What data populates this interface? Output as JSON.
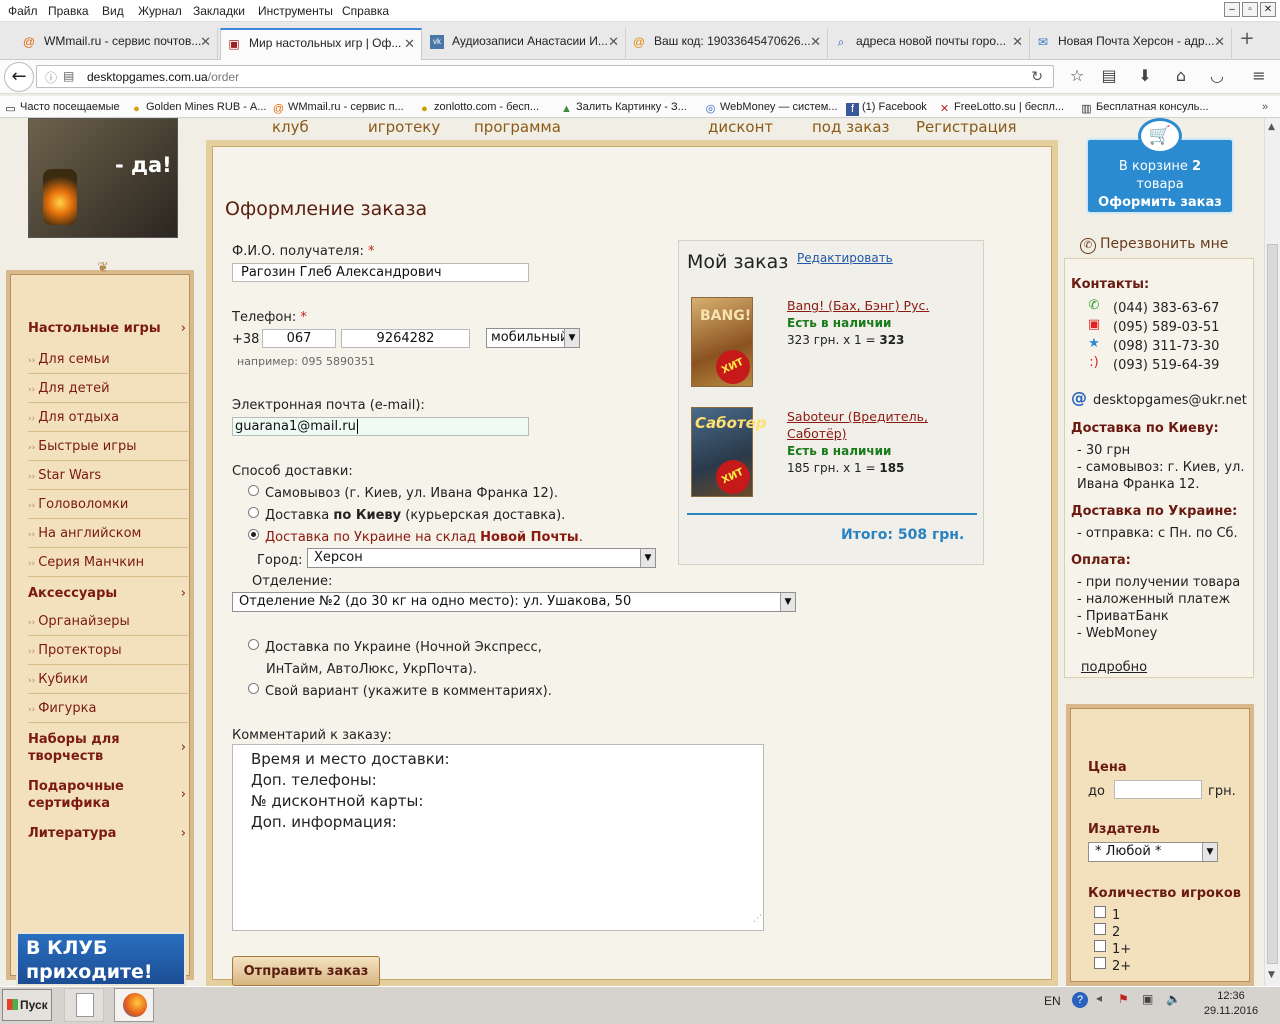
{
  "menubar": {
    "items": [
      "Файл",
      "Правка",
      "Вид",
      "Журнал",
      "Закладки",
      "Инструменты",
      "Справка"
    ]
  },
  "tabs": [
    {
      "label": "WMmail.ru - сервис почтов...",
      "icon": "at-icon"
    },
    {
      "label": "Мир настольных игр | Оф...",
      "icon": "boardgame-icon"
    },
    {
      "label": "Аудиозаписи Анастасии И...",
      "icon": "vk-icon"
    },
    {
      "label": "Ваш код: 19033645470626...",
      "icon": "mail-icon"
    },
    {
      "label": "адреса новой почты горо...",
      "icon": "search-icon"
    },
    {
      "label": "Новая Почта Херсон - адр...",
      "icon": "envelope-icon"
    }
  ],
  "url": {
    "host": "desktopgames.com.ua",
    "path": "/order"
  },
  "bookmarks": [
    "Часто посещаемые",
    "Golden Mines RUB - А...",
    "WMmail.ru - сервис п...",
    "zonlotto.com - бесп...",
    "Залить Картинку - З...",
    "WebMoney — систем...",
    "(1) Facebook",
    "FreeLotto.su | беспл...",
    "Бесплатная консуль..."
  ],
  "topnav": [
    "клуб",
    "игротеку",
    "программа",
    "дисконт",
    "под заказ",
    "Регистрация"
  ],
  "promo": {
    "text": "- да!"
  },
  "leftmenu": {
    "items": [
      {
        "type": "h",
        "label": "Настольные игры"
      },
      {
        "type": "i",
        "label": "Для семьи"
      },
      {
        "type": "i",
        "label": "Для детей"
      },
      {
        "type": "i",
        "label": "Для отдыха"
      },
      {
        "type": "i",
        "label": "Быстрые игры"
      },
      {
        "type": "i",
        "label": "Star Wars"
      },
      {
        "type": "i",
        "label": "Головоломки"
      },
      {
        "type": "i",
        "label": "На английском"
      },
      {
        "type": "i",
        "label": "Серия Манчкин"
      },
      {
        "type": "h",
        "label": "Аксессуары"
      },
      {
        "type": "i",
        "label": "Органайзеры"
      },
      {
        "type": "i",
        "label": "Протекторы"
      },
      {
        "type": "i",
        "label": "Кубики"
      },
      {
        "type": "i",
        "label": "Фигурка"
      },
      {
        "type": "h",
        "label": "Наборы для творчеств"
      },
      {
        "type": "h",
        "label": "Подарочные сертифика"
      },
      {
        "type": "h",
        "label": "Литература"
      }
    ]
  },
  "klub": {
    "line1": "В КЛУБ",
    "line2": "приходите!"
  },
  "form": {
    "title": "Оформление заказа",
    "fio_label": "Ф.И.О. получателя:",
    "fio_value": "Рагозин Глеб Александрович",
    "phone_label": "Телефон:",
    "phone_prefix": "+38",
    "phone_code": "067",
    "phone_number": "9264282",
    "phone_type": "мобильный",
    "phone_hint": "например: 095  5890351",
    "email_label": "Электронная почта (e-mail):",
    "email_value": "guarana1@mail.ru",
    "delivery_label": "Способ доставки:",
    "d1": "Самовывоз (г. Киев, ул. Ивана Франка 12).",
    "d2a": "Доставка ",
    "d2b": "по Киеву",
    "d2c": " (курьерская доставка).",
    "d3a": "Доставка по Украине на склад ",
    "d3b": "Новой Почты",
    "d3c": ".",
    "city_label": "Город:",
    "city_value": "Херсон",
    "branch_label": "Отделение:",
    "branch_value": "Отделение №2 (до 30 кг на одно место): ул. Ушакова, 50",
    "d4a": "Доставка по Украине (Ночной Экспресс,",
    "d4b": "ИнТайм, АвтоЛюкс, УкрПочта).",
    "d5": "Свой вариант (укажите в комментариях).",
    "comment_label": "Комментарий к заказу:",
    "comment_lines": [
      "Время и место доставки:",
      "Доп. телефоны:",
      "№ дисконтной карты:",
      "Доп. информация:"
    ],
    "submit": "Отправить заказ"
  },
  "order": {
    "title": "Мой заказ",
    "edit": "Редактировать",
    "items": [
      {
        "name": "Bang! (Бах, Бэнг) Рус.",
        "stock": "Есть в наличии",
        "price_text": "323 грн. x 1 = ",
        "sum": "323",
        "badge": "ХИТ",
        "img_text": "BANG!"
      },
      {
        "name": "Saboteur (Вредитель, Саботёр)",
        "stock": "Есть в наличии",
        "price_text": "185 грн. x 1 = ",
        "sum": "185",
        "badge": "ХИТ",
        "img_text": "Саботер"
      }
    ],
    "total": "Итого: 508 грн."
  },
  "cart": {
    "line1a": "В корзине ",
    "count": "2",
    "line2": "товара",
    "action": "Оформить заказ"
  },
  "callback": "Перезвонить мне",
  "contacts": {
    "title": "Контакты:",
    "phones": [
      "(044) 383-63-67",
      "(095) 589-03-51",
      "(098) 311-73-30",
      "(093) 519-64-39"
    ],
    "email": "desktopgames@ukr.net",
    "kiev_title": "Доставка по Киеву:",
    "kiev_lines": [
      "- 30 грн",
      "- самовывоз: г. Киев, ул.",
      "Ивана Франка 12."
    ],
    "ukr_title": "Доставка по Украине:",
    "ukr_lines": [
      "- отправка: с Пн. по Сб."
    ],
    "pay_title": "Оплата:",
    "pay_lines": [
      "- при получении товара",
      "- наложенный платеж",
      "- ПриватБанк",
      "- WebMoney"
    ],
    "more": "подробно"
  },
  "filters": {
    "price": "Цена",
    "to": "до",
    "cur": "грн.",
    "publisher": "Издатель",
    "publisher_value": "* Любой *",
    "players": "Количество игроков",
    "players_opts": [
      "1",
      "2",
      "1+",
      "2+"
    ]
  },
  "taskbar": {
    "start": "Пуск",
    "lang": "EN",
    "time": "12:36",
    "date": "29.11.2016"
  },
  "colors": {
    "accent": "#2a8bd0",
    "brand_dark": "#7a1a10",
    "panel": "#f3e1be"
  }
}
